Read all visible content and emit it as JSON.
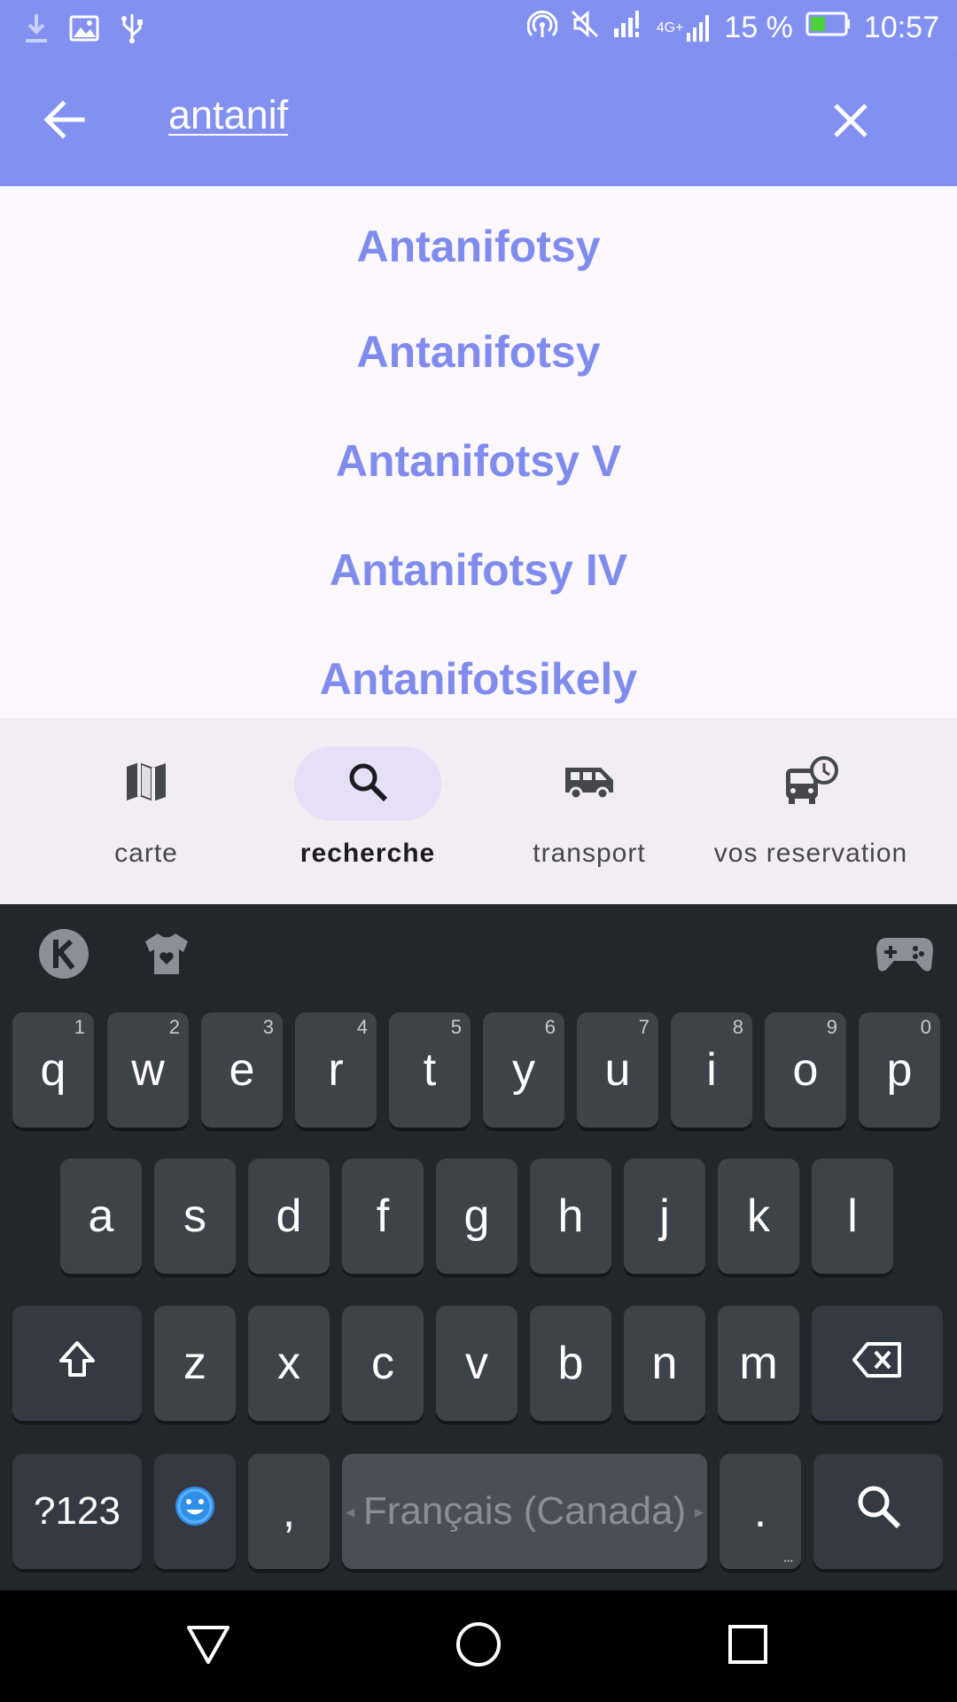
{
  "status_bar": {
    "battery_percent": "15 %",
    "time": "10:57",
    "network_label": "4G+",
    "left_icons": [
      "download-icon",
      "image-icon",
      "usb-icon"
    ],
    "right_icons": [
      "hotspot-icon",
      "mute-icon",
      "signal-icon",
      "signal-4g-icon",
      "battery-icon"
    ]
  },
  "app_bar": {
    "search_value": "antanif",
    "back_icon": "arrow-left-icon",
    "clear_icon": "close-icon"
  },
  "results": [
    "Antanifotsy",
    "Antanifotsy",
    "Antanifotsy V",
    "Antanifotsy IV",
    "Antanifotsikely"
  ],
  "bottom_nav": {
    "items": [
      {
        "label": "carte",
        "icon": "map-icon",
        "active": false
      },
      {
        "label": "recherche",
        "icon": "search-icon",
        "active": true
      },
      {
        "label": "transport",
        "icon": "van-icon",
        "active": false
      },
      {
        "label": "vos reservation",
        "icon": "bus-clock-icon",
        "active": false
      }
    ]
  },
  "keyboard": {
    "row1": [
      {
        "key": "q",
        "hint": "1"
      },
      {
        "key": "w",
        "hint": "2"
      },
      {
        "key": "e",
        "hint": "3"
      },
      {
        "key": "r",
        "hint": "4"
      },
      {
        "key": "t",
        "hint": "5"
      },
      {
        "key": "y",
        "hint": "6"
      },
      {
        "key": "u",
        "hint": "7"
      },
      {
        "key": "i",
        "hint": "8"
      },
      {
        "key": "o",
        "hint": "9"
      },
      {
        "key": "p",
        "hint": "0"
      }
    ],
    "row2": [
      "a",
      "s",
      "d",
      "f",
      "g",
      "h",
      "j",
      "k",
      "l"
    ],
    "row3": [
      "z",
      "x",
      "c",
      "v",
      "b",
      "n",
      "m"
    ],
    "symbols_label": "?123",
    "comma_label": ",",
    "space_label": "Français (Canada)",
    "period_label": ".",
    "period_more": "...",
    "toolbar_icons": [
      "kika-logo-icon",
      "theme-shirt-icon",
      "gamepad-icon"
    ]
  },
  "colors": {
    "primary": "#8291f1",
    "result_text": "#7f8ced",
    "nav_bg": "#f1edf3",
    "nav_active_pill": "#e5e0f7",
    "keyboard_bg": "#23262b",
    "key_bg": "#3e4249",
    "battery_fill": "#4cd137"
  }
}
